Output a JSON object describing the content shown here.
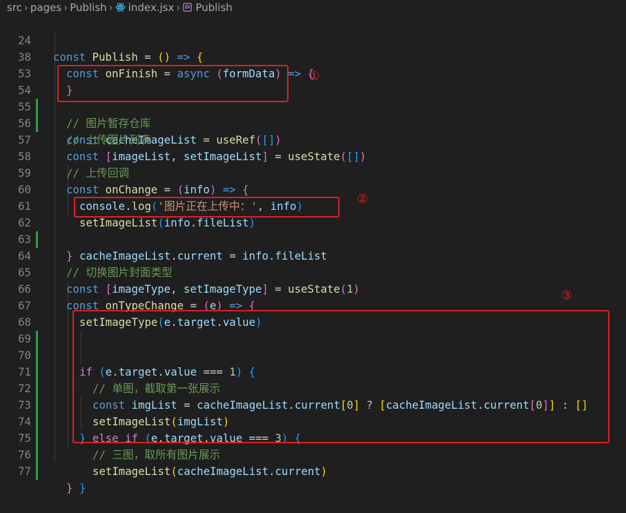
{
  "breadcrumb": {
    "src": "src",
    "pages": "pages",
    "publish": "Publish",
    "file": "index.jsx",
    "symbol": "Publish"
  },
  "markers": {
    "m1": "①",
    "m2": "②",
    "m3": "③"
  },
  "lines": [
    {
      "n": "24",
      "t": "const Publish = () => {"
    },
    {
      "n": "38",
      "t": "const onFinish = async (formData) => {"
    },
    {
      "n": "53",
      "t": "}"
    },
    {
      "n": "54",
      "t": "// 图片暂存仓库"
    },
    {
      "n": "55",
      "t": "const cacheImageList = useRef([])"
    },
    {
      "n": "56",
      "t": "// 上传图片列表"
    },
    {
      "n": "57",
      "t": "const [imageList, setImageList] = useState([])"
    },
    {
      "n": "58",
      "t": "// 上传回调"
    },
    {
      "n": "59",
      "t": "const onChange = (info) => {"
    },
    {
      "n": "60",
      "t": "console.log('图片正在上传中：', info)"
    },
    {
      "n": "61",
      "t": "setImageList(info.fileList)"
    },
    {
      "n": "62",
      "t": "cacheImageList.current = info.fileList"
    },
    {
      "n": "63",
      "t": "}"
    },
    {
      "n": "64",
      "t": "// 切换图片封面类型"
    },
    {
      "n": "65",
      "t": "const [imageType, setImageType] = useState(1)"
    },
    {
      "n": "66",
      "t": "const onTypeChange = (e) => {"
    },
    {
      "n": "67",
      "t": "setImageType(e.target.value)"
    },
    {
      "n": "68",
      "t": ""
    },
    {
      "n": "69",
      "t": "if (e.target.value === 1) {"
    },
    {
      "n": "70",
      "t": "// 单图，截取第一张展示"
    },
    {
      "n": "71",
      "t": "const imgList = cacheImageList.current[0] ? [cacheImageList.current[0]] : []"
    },
    {
      "n": "72",
      "t": "setImageList(imgList)"
    },
    {
      "n": "73",
      "t": "} else if (e.target.value === 3) {"
    },
    {
      "n": "74",
      "t": "// 三图，取所有图片展示"
    },
    {
      "n": "75",
      "t": "setImageList(cacheImageList.current)"
    },
    {
      "n": "76",
      "t": "}"
    },
    {
      "n": "77",
      "t": "}"
    }
  ]
}
